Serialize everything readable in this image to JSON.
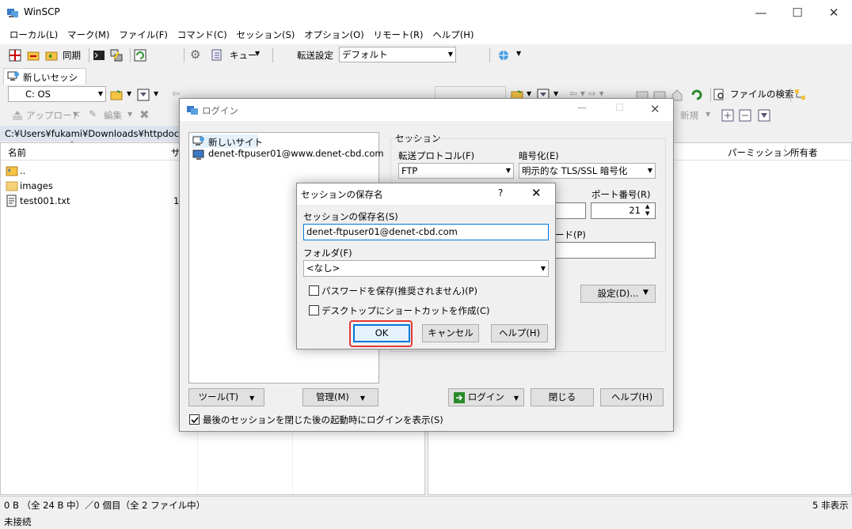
{
  "window": {
    "title": "WinSCP"
  },
  "menu": [
    "ローカル(L)",
    "マーク(M)",
    "ファイル(F)",
    "コマンド(C)",
    "セッション(S)",
    "オプション(O)",
    "リモート(R)",
    "ヘルプ(H)"
  ],
  "toolbar": {
    "sync_label": "同期",
    "queue_label": "キュー",
    "transfer_label": "転送設定",
    "transfer_value": "デフォルト"
  },
  "session_tab": {
    "label": "新しいセッション"
  },
  "local": {
    "drive": "C: OS",
    "upload_label": "アップロード",
    "edit_label": "編集",
    "path": "C:¥Users¥fukami¥Downloads¥httpdocs¥",
    "col_name": "名前",
    "col_size": "サ",
    "files": [
      {
        "name": "..",
        "size": ""
      },
      {
        "name": "images",
        "size": ""
      },
      {
        "name": "test001.txt",
        "size": "1"
      }
    ]
  },
  "remote": {
    "find_label": "ファイルの検索",
    "new_label": "新規",
    "col_perm": "パーミッション",
    "col_owner": "所有者"
  },
  "status": {
    "left": "0 B （全 24 B 中）／0 個目（全 2 ファイル中）",
    "right": "5 非表示",
    "connection": "未接続"
  },
  "login": {
    "title": "ログイン",
    "sites": [
      "新しいサイト",
      "denet-ftpuser01@www.denet-cbd.com"
    ],
    "session_group": "セッション",
    "protocol_label": "転送プロトコル(F)",
    "protocol_value": "FTP",
    "encryption_label": "暗号化(E)",
    "encryption_value": "明示的な TLS/SSL 暗号化",
    "port_label": "ポート番号(R)",
    "port_value": "21",
    "password_label": "ード(P)",
    "password_value": "●●●●●●●",
    "settings_btn": "設定(D)...",
    "tools_btn": "ツール(T)",
    "manage_btn": "管理(M)",
    "login_btn": "ログイン",
    "close_btn": "閉じる",
    "help_btn": "ヘルプ(H)",
    "show_login_label": "最後のセッションを閉じた後の起動時にログインを表示(S)"
  },
  "save_dialog": {
    "title": "セッションの保存名",
    "question": "?",
    "name_label": "セッションの保存名(S)",
    "name_value": "denet-ftpuser01@denet-cbd.com",
    "folder_label": "フォルダ(F)",
    "folder_value": "<なし>",
    "save_password_label": "パスワードを保存(推奨されません)(P)",
    "shortcut_label": "デスクトップにショートカットを作成(C)",
    "ok_btn": "OK",
    "cancel_btn": "キャンセル",
    "help_btn": "ヘルプ(H)"
  },
  "colors": {
    "highlight": "#e53935",
    "focus": "#0078d7"
  }
}
